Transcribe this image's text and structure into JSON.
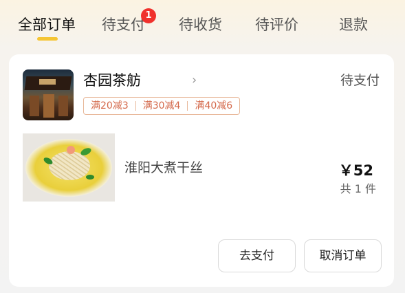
{
  "tabs": {
    "all": "全部订单",
    "to_pay": "待支付",
    "to_pay_badge": "1",
    "to_receive": "待收货",
    "to_review": "待评价",
    "refund": "退款"
  },
  "order": {
    "store_name": "杏园茶舫",
    "chevron": "›",
    "status": "待支付",
    "promotions": [
      "满20减3",
      "满30减4",
      "满40减6"
    ],
    "item": {
      "name": "淮阳大煮干丝",
      "price": "￥52",
      "quantity": "共 1 件"
    },
    "buttons": {
      "pay": "去支付",
      "cancel": "取消订单"
    }
  },
  "colors": {
    "accent": "#f5c534",
    "badge": "#f0312c",
    "promo": "#d4684a"
  }
}
